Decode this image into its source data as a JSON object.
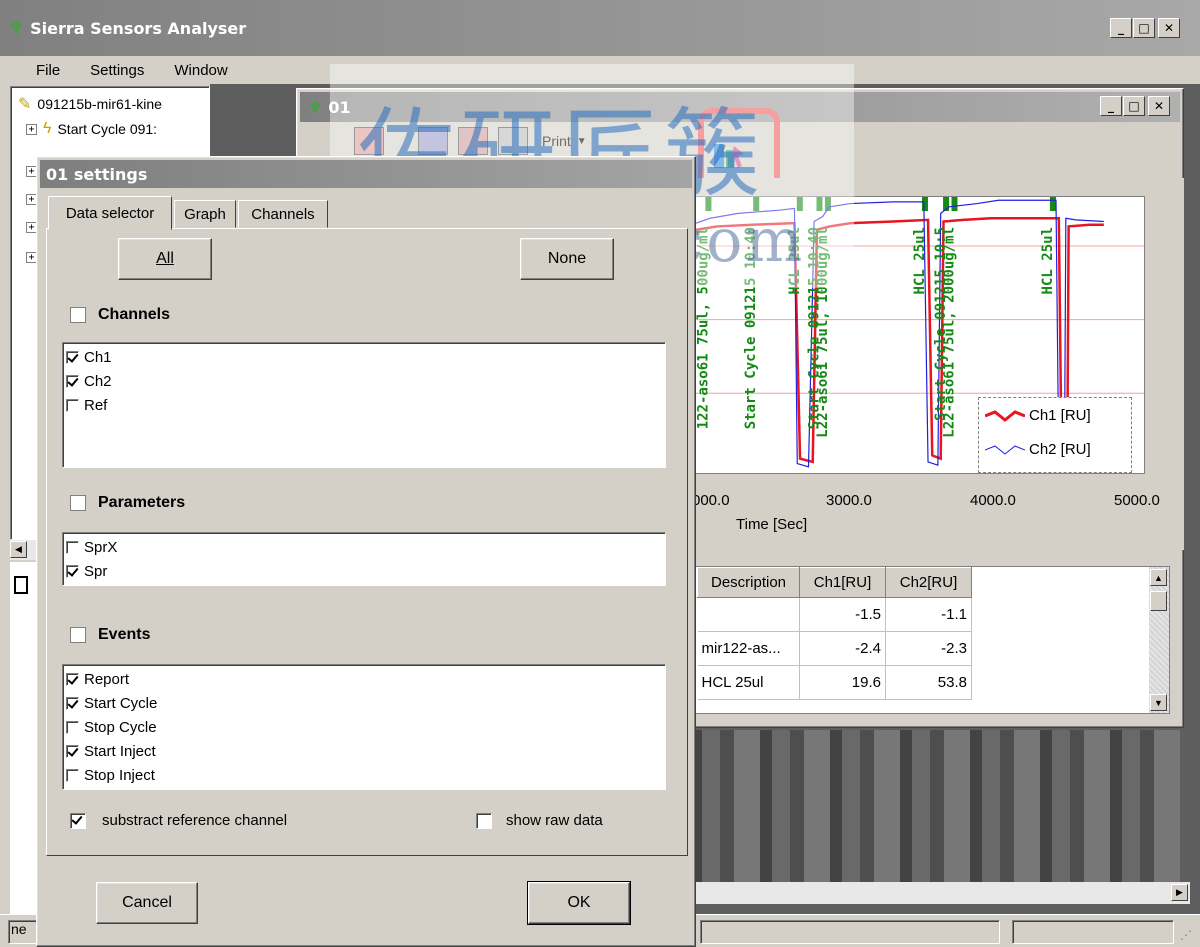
{
  "app": {
    "title": "Sierra Sensors Analyser"
  },
  "menu": [
    "File",
    "Settings",
    "Window"
  ],
  "tree": {
    "root": "091215b-mir61-kine",
    "child": "Start Cycle 091:"
  },
  "child_window": {
    "title": "01",
    "print_label": "Print"
  },
  "watermark": {
    "cn": "佑研匠簇",
    "url": "ulab360.com"
  },
  "chart_data": {
    "type": "line",
    "xlabel": "Time [Sec]",
    "x_ticks": [
      "000.0",
      "3000.0",
      "4000.0",
      "5000.0"
    ],
    "xlim": [
      1900,
      5100
    ],
    "ylim": [
      -60,
      110
    ],
    "legend": {
      "position": "bottom-right",
      "items": [
        "Ch1 [RU]",
        "Ch2 [RU]"
      ]
    },
    "series": [
      {
        "name": "Ch1 [RU]",
        "color": "#e8141e",
        "points": [
          [
            1900,
            90
          ],
          [
            2050,
            92
          ],
          [
            2300,
            93
          ],
          [
            2600,
            94
          ],
          [
            2640,
            -50
          ],
          [
            2730,
            -52
          ],
          [
            2760,
            90
          ],
          [
            2850,
            92
          ],
          [
            3000,
            94
          ],
          [
            3300,
            95
          ],
          [
            3550,
            96
          ],
          [
            3580,
            -48
          ],
          [
            3640,
            -50
          ],
          [
            3660,
            95
          ],
          [
            3800,
            96
          ],
          [
            4000,
            97
          ],
          [
            4300,
            97
          ],
          [
            4480,
            97
          ],
          [
            4500,
            -52
          ],
          [
            4540,
            -52
          ],
          [
            4550,
            92
          ],
          [
            4700,
            93
          ],
          [
            4800,
            93
          ]
        ]
      },
      {
        "name": "Ch2 [RU]",
        "color": "#2020e0",
        "points": [
          [
            1900,
            94
          ],
          [
            2000,
            97
          ],
          [
            2200,
            100
          ],
          [
            2500,
            102
          ],
          [
            2600,
            103
          ],
          [
            2620,
            -53
          ],
          [
            2700,
            -55
          ],
          [
            2740,
            95
          ],
          [
            2800,
            98
          ],
          [
            2850,
            104
          ],
          [
            3000,
            106
          ],
          [
            3300,
            107
          ],
          [
            3520,
            107
          ],
          [
            3550,
            -52
          ],
          [
            3620,
            -54
          ],
          [
            3640,
            100
          ],
          [
            3700,
            104
          ],
          [
            3900,
            106
          ],
          [
            4050,
            108
          ],
          [
            4300,
            108
          ],
          [
            4460,
            108
          ],
          [
            4480,
            -54
          ],
          [
            4520,
            -54
          ],
          [
            4530,
            97
          ],
          [
            4600,
            96
          ],
          [
            4800,
            95
          ]
        ]
      }
    ],
    "event_labels": [
      {
        "text": "Start Cycle 091215 10:40",
        "x": 2250
      },
      {
        "text": "122-aso61 75ul, 500ug/ml",
        "x": 1910
      },
      {
        "text": "HCL 25ul",
        "x": 2560
      },
      {
        "text": "Start Cycle 091215 10:40",
        "x": 2700
      },
      {
        "text": "L22-aso61 75ul, 1000ug/ml",
        "x": 2760
      },
      {
        "text": "HCL 25ul",
        "x": 3450
      },
      {
        "text": "Start Cycle 091215 10:5",
        "x": 3600
      },
      {
        "text": "L22-aso61 75ul, 2000ug/ml",
        "x": 3660
      },
      {
        "text": "HCL 25ul",
        "x": 4360
      }
    ]
  },
  "table": {
    "columns": [
      "Description",
      "Ch1[RU]",
      "Ch2[RU]"
    ],
    "rows": [
      [
        "",
        "-1.5",
        "-1.1"
      ],
      [
        "mir122-as...",
        "-2.4",
        "-2.3"
      ],
      [
        "HCL 25ul",
        "19.6",
        "53.8"
      ]
    ]
  },
  "status": {
    "left": "ne"
  },
  "dialog": {
    "title": "01 settings",
    "tabs": [
      "Data selector",
      "Graph",
      "Channels"
    ],
    "all_button": "All",
    "none_button": "None",
    "channels": {
      "label": "Channels",
      "items": [
        {
          "label": "Ch1",
          "checked": true
        },
        {
          "label": "Ch2",
          "checked": true
        },
        {
          "label": "Ref",
          "checked": false
        }
      ]
    },
    "parameters": {
      "label": "Parameters",
      "items": [
        {
          "label": "SprX",
          "checked": false
        },
        {
          "label": "Spr",
          "checked": true
        }
      ]
    },
    "events": {
      "label": "Events",
      "items": [
        {
          "label": "Report",
          "checked": true
        },
        {
          "label": "Start Cycle",
          "checked": true
        },
        {
          "label": "Stop Cycle",
          "checked": false
        },
        {
          "label": "Start Inject",
          "checked": true
        },
        {
          "label": "Stop Inject",
          "checked": false
        }
      ]
    },
    "substract_label": "substract reference channel",
    "substract_checked": true,
    "raw_label": "show raw data",
    "raw_checked": false,
    "cancel_button": "Cancel",
    "ok_button": "OK"
  }
}
